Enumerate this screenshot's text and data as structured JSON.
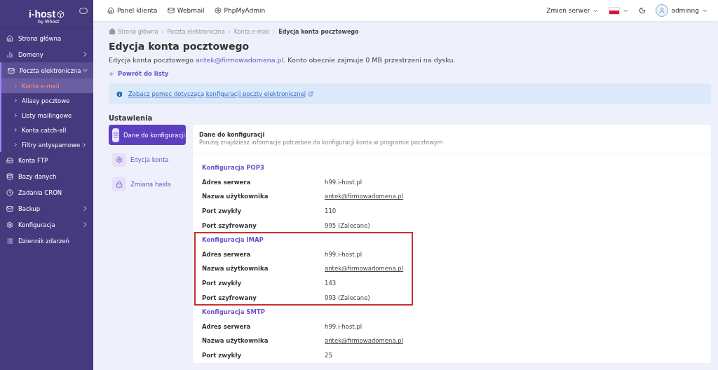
{
  "logo": {
    "name": "i-host",
    "tagline": "by Whost"
  },
  "sidebar": {
    "items": [
      {
        "label": "Strona główna",
        "has_arrow": false,
        "expanded": false
      },
      {
        "label": "Domeny",
        "has_arrow": true,
        "expanded": false
      },
      {
        "label": "Poczta elektroniczna",
        "has_arrow": true,
        "expanded": true,
        "children": [
          {
            "label": "Konta e-mail",
            "selected": true,
            "has_arrow": false
          },
          {
            "label": "Aliasy pocztowe",
            "selected": false,
            "has_arrow": false
          },
          {
            "label": "Listy mailingowe",
            "selected": false,
            "has_arrow": false
          },
          {
            "label": "Konta catch-all",
            "selected": false,
            "has_arrow": false
          },
          {
            "label": "Filtry antyspamowe",
            "selected": false,
            "has_arrow": true
          }
        ]
      },
      {
        "label": "Konta FTP",
        "has_arrow": false,
        "expanded": false
      },
      {
        "label": "Bazy danych",
        "has_arrow": false,
        "expanded": false
      },
      {
        "label": "Zadania CRON",
        "has_arrow": false,
        "expanded": false
      },
      {
        "label": "Backup",
        "has_arrow": true,
        "expanded": false
      },
      {
        "label": "Konfiguracja",
        "has_arrow": true,
        "expanded": false
      },
      {
        "label": "Dziennik zdarzeń",
        "has_arrow": false,
        "expanded": false
      }
    ]
  },
  "topbar": {
    "links": [
      "Panel klienta",
      "Webmail",
      "PhpMyAdmin"
    ],
    "server_switch": "Zmień serwer",
    "user": "adminng"
  },
  "breadcrumb": [
    "Strona główna",
    "Poczta elektroniczna",
    "Konta e-mail",
    "Edycja konta pocztowego"
  ],
  "page": {
    "title": "Edycja konta pocztowego",
    "description_before": "Edycja konta pocztowego ",
    "description_email": "antek@firmowadomena.pl",
    "description_after": ". Konto obecnie zajmuje 0 MB przestrzeni na dysku.",
    "back_link": "Powrót do listy",
    "info_link": "Zobacz pomoc dotyczącą konfiguracji poczty elektronicznej"
  },
  "settings": {
    "title": "Ustawienia",
    "tabs": [
      {
        "label": "Dane do konfiguracji",
        "selected": true
      },
      {
        "label": "Edycja konta",
        "selected": false
      },
      {
        "label": "Zmiana hasła",
        "selected": false
      }
    ]
  },
  "card": {
    "title": "Dane do konfiguracji",
    "subtitle": "Poniżej znajdziesz informacje potrzebne do konfiguracji konta w programie pocztowym",
    "sections": [
      {
        "title": "Konfiguracja POP3",
        "highlighted": false,
        "rows": [
          {
            "label": "Adres serwera",
            "value": "h99.i-host.pl",
            "kind": "text"
          },
          {
            "label": "Nazwa użytkownika",
            "value": "antek@firmowadomena.pl",
            "kind": "link"
          },
          {
            "label": "Port zwykły",
            "value": "110",
            "kind": "text"
          },
          {
            "label": "Port szyfrowany",
            "value": "995 (Zalecane)",
            "kind": "text"
          }
        ]
      },
      {
        "title": "Konfiguracja IMAP",
        "highlighted": true,
        "rows": [
          {
            "label": "Adres serwera",
            "value": "h99.i-host.pl",
            "kind": "text"
          },
          {
            "label": "Nazwa użytkownika",
            "value": "antek@firmowadomena.pl",
            "kind": "link"
          },
          {
            "label": "Port zwykły",
            "value": "143",
            "kind": "text"
          },
          {
            "label": "Port szyfrowany",
            "value": "993 (Zalecane)",
            "kind": "text"
          }
        ]
      },
      {
        "title": "Konfiguracja SMTP",
        "highlighted": false,
        "rows": [
          {
            "label": "Adres serwera",
            "value": "h99.i-host.pl",
            "kind": "text"
          },
          {
            "label": "Nazwa użytkownika",
            "value": "antek@firmowadomena.pl",
            "kind": "link"
          },
          {
            "label": "Port zwykły",
            "value": "25",
            "kind": "text"
          }
        ]
      }
    ]
  }
}
